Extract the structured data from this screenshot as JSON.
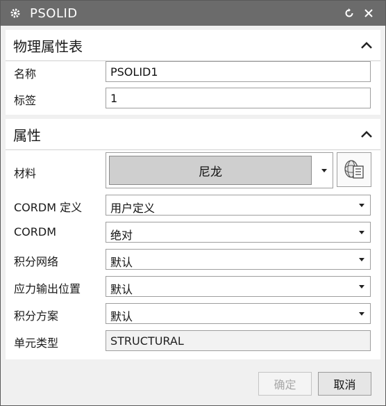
{
  "window": {
    "title": "PSOLID"
  },
  "section1": {
    "title": "物理属性表",
    "name_label": "名称",
    "name_value": "PSOLID1",
    "tag_label": "标签",
    "tag_value": "1"
  },
  "section2": {
    "title": "属性",
    "material_label": "材料",
    "material_value": "尼龙",
    "cordm_def_label": "CORDM 定义",
    "cordm_def_value": "用户定义",
    "cordm_label": "CORDM",
    "cordm_value": "绝对",
    "integ_net_label": "积分网络",
    "integ_net_value": "默认",
    "stress_out_label": "应力输出位置",
    "stress_out_value": "默认",
    "integ_scheme_label": "积分方案",
    "integ_scheme_value": "默认",
    "elem_type_label": "单元类型",
    "elem_type_value": "STRUCTURAL"
  },
  "footer": {
    "ok_label": "确定",
    "cancel_label": "取消"
  }
}
